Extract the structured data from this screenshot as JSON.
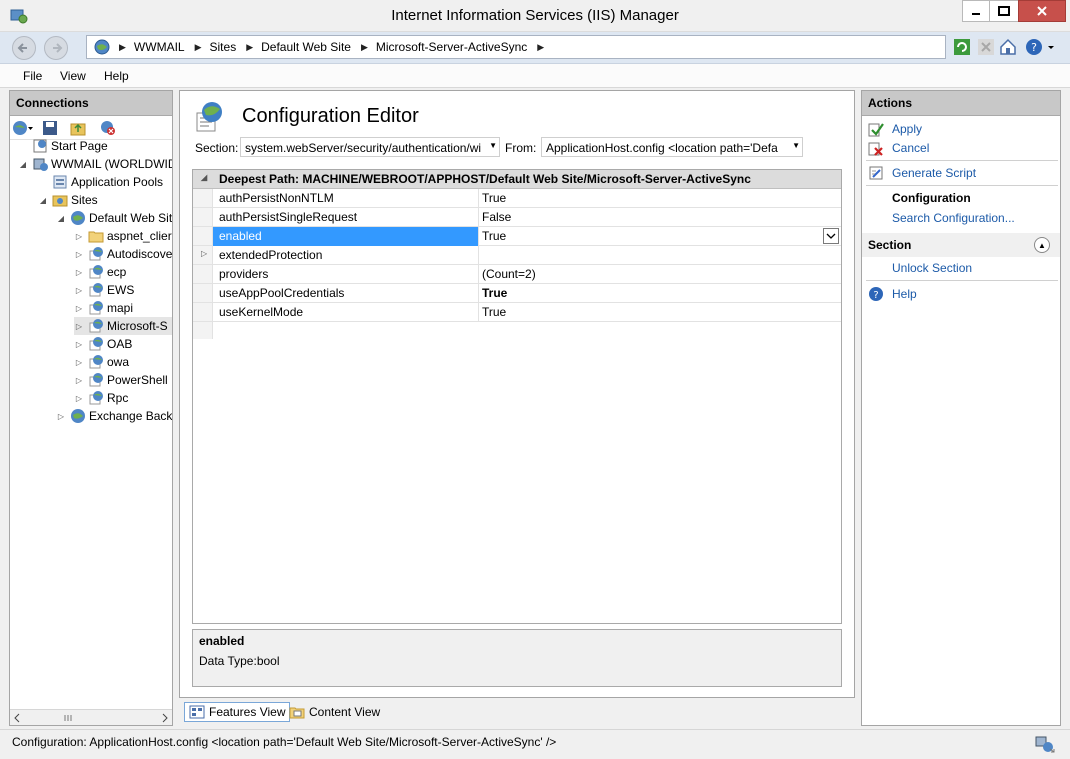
{
  "window": {
    "title": "Internet Information Services (IIS) Manager"
  },
  "breadcrumbs": [
    "WWMAIL",
    "Sites",
    "Default Web Site",
    "Microsoft-Server-ActiveSync"
  ],
  "menu": [
    "File",
    "View",
    "Help"
  ],
  "connections": {
    "header": "Connections",
    "tree": [
      {
        "label": "Start Page",
        "icon": "start-page-icon"
      },
      {
        "label": "WWMAIL (WORLDWID",
        "icon": "server-icon"
      },
      {
        "label": "Application Pools",
        "icon": "app-pools-icon"
      },
      {
        "label": "Sites",
        "icon": "sites-folder-icon"
      },
      {
        "label": "Default Web Sit",
        "icon": "globe-icon"
      },
      {
        "label": "aspnet_clier",
        "icon": "folder-icon"
      },
      {
        "label": "Autodiscove",
        "icon": "web-app-icon"
      },
      {
        "label": "ecp",
        "icon": "web-app-icon"
      },
      {
        "label": "EWS",
        "icon": "web-app-icon"
      },
      {
        "label": "mapi",
        "icon": "web-app-icon"
      },
      {
        "label": "Microsoft-S",
        "icon": "web-app-icon"
      },
      {
        "label": "OAB",
        "icon": "web-app-icon"
      },
      {
        "label": "owa",
        "icon": "web-app-icon"
      },
      {
        "label": "PowerShell",
        "icon": "web-app-icon"
      },
      {
        "label": "Rpc",
        "icon": "web-app-icon"
      },
      {
        "label": "Exchange Back",
        "icon": "globe-icon"
      }
    ]
  },
  "editor": {
    "title": "Configuration Editor",
    "section_label": "Section:",
    "section_value": "system.webServer/security/authentication/wi",
    "from_label": "From:",
    "from_value": "ApplicationHost.config <location path='Defa",
    "grid_header": "Deepest Path: MACHINE/WEBROOT/APPHOST/Default Web Site/Microsoft-Server-ActiveSync",
    "rows": [
      {
        "key": "authPersistNonNTLM",
        "value": "True"
      },
      {
        "key": "authPersistSingleRequest",
        "value": "False"
      },
      {
        "key": "enabled",
        "value": "True"
      },
      {
        "key": "extendedProtection",
        "value": ""
      },
      {
        "key": "providers",
        "value": "(Count=2)"
      },
      {
        "key": "useAppPoolCredentials",
        "value": "True"
      },
      {
        "key": "useKernelMode",
        "value": "True"
      }
    ],
    "description": {
      "title": "enabled",
      "detail": "Data Type:bool"
    }
  },
  "view_tabs": {
    "features": "Features View",
    "content": "Content View"
  },
  "actions": {
    "header": "Actions",
    "apply": "Apply",
    "cancel": "Cancel",
    "generate_script": "Generate Script",
    "configuration": "Configuration",
    "search_configuration": "Search Configuration...",
    "section_header": "Section",
    "unlock_section": "Unlock Section",
    "help": "Help"
  },
  "status": "Configuration: ApplicationHost.config <location path='Default Web Site/Microsoft-Server-ActiveSync' />",
  "colors": {
    "selection": "#3399ff",
    "link": "#1c5aa8",
    "close": "#c7504b",
    "nav": "#dee7f2"
  }
}
